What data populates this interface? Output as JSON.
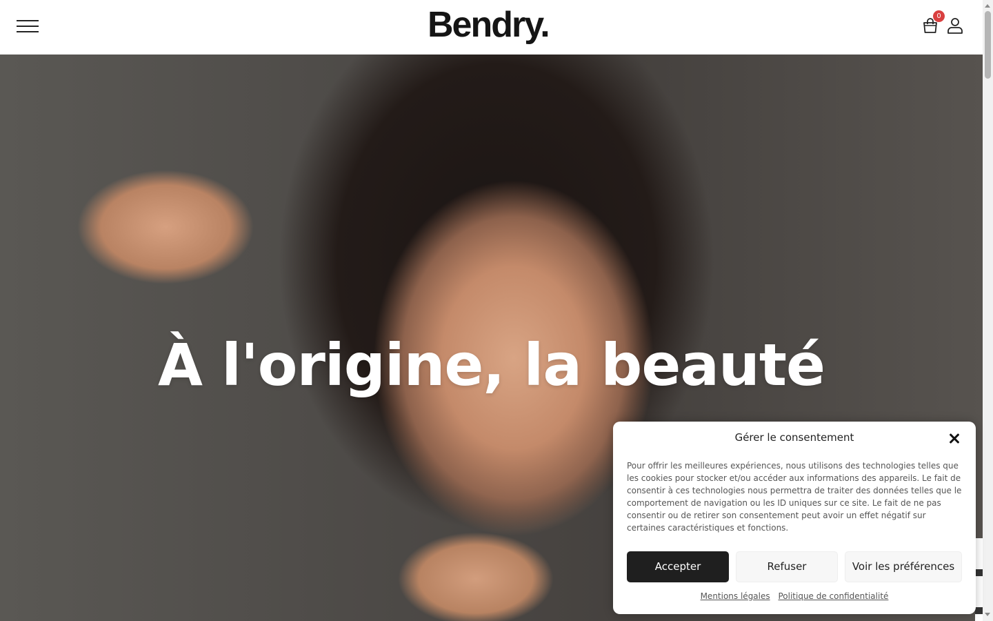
{
  "header": {
    "menu_icon": "hamburger-menu-icon",
    "logo_text": "Bendry",
    "logo_dot": ".",
    "cart_icon": "shopping-bag-icon",
    "cart_count": "0",
    "account_icon": "user-icon"
  },
  "hero": {
    "title": "À l'origine, la beauté"
  },
  "consent": {
    "title": "Gérer le consentement",
    "close_icon": "close-icon",
    "body": "Pour offrir les meilleures expériences, nous utilisons des technologies telles que les cookies pour stocker et/ou accéder aux informations des appareils. Le fait de consentir à ces technologies nous permettra de traiter des données telles que le comportement de navigation ou les ID uniques sur ce site. Le fait de ne pas consentir ou de retirer son consentement peut avoir un effet négatif sur certaines caractéristiques et fonctions.",
    "accept_label": "Accepter",
    "refuse_label": "Refuser",
    "prefs_label": "Voir les préférences",
    "link_legal": "Mentions légales",
    "link_privacy": "Politique de confidentialité"
  },
  "colors": {
    "accent_dark": "#1f1f1f",
    "badge_red": "#d94040"
  }
}
